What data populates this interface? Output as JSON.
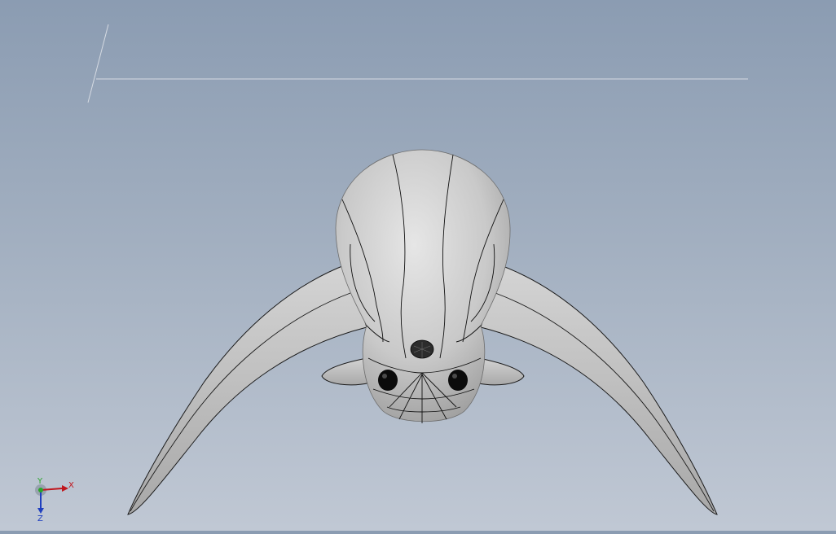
{
  "viewport": {
    "background_top": "#8b9cb2",
    "background_bottom": "#c0c8d4",
    "model_fill": "#c8c8c8",
    "edge_color": "#111111",
    "eye_color": "#0b0b0b"
  },
  "model": {
    "name_icon": "cad-part-model-icon"
  },
  "triad": {
    "x_label": "X",
    "y_label": "Y",
    "z_label": "Z",
    "x_color": "#c0161d",
    "y_color": "#2aa52a",
    "z_color": "#1f3fbf"
  }
}
